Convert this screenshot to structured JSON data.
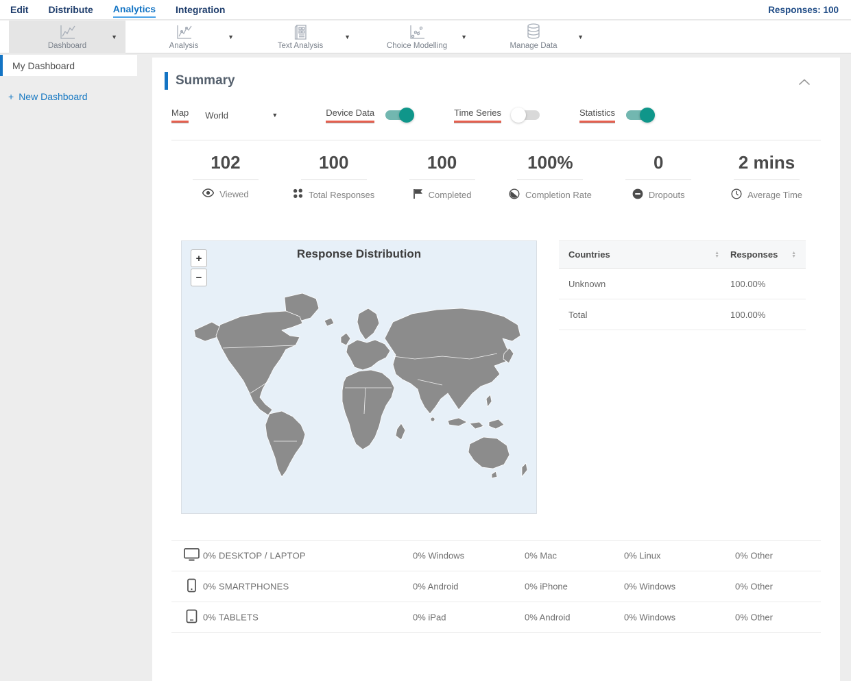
{
  "top_nav": {
    "items": [
      {
        "label": "Edit",
        "active": false
      },
      {
        "label": "Distribute",
        "active": false
      },
      {
        "label": "Analytics",
        "active": true
      },
      {
        "label": "Integration",
        "active": false
      }
    ],
    "responses_label": "Responses: 100"
  },
  "toolbar": {
    "items": [
      {
        "label": "Dashboard",
        "icon": "dashboard-chart-icon",
        "selected": true
      },
      {
        "label": "Analysis",
        "icon": "analysis-chart-icon",
        "selected": false
      },
      {
        "label": "Text Analysis",
        "icon": "text-analysis-document-icon",
        "selected": false
      },
      {
        "label": "Choice Modelling",
        "icon": "choice-modelling-scatter-icon",
        "selected": false
      },
      {
        "label": "Manage Data",
        "icon": "database-icon",
        "selected": false
      }
    ]
  },
  "sidebar": {
    "items": [
      {
        "label": "My Dashboard",
        "active": true
      }
    ],
    "new_dashboard": {
      "plus": "+",
      "label": "New Dashboard"
    }
  },
  "summary": {
    "title": "Summary",
    "controls": {
      "map_label": "Map",
      "map_value": "World",
      "toggles": [
        {
          "label": "Device Data",
          "on": true
        },
        {
          "label": "Time Series",
          "on": false
        },
        {
          "label": "Statistics",
          "on": true
        }
      ]
    },
    "stats": [
      {
        "value": "102",
        "label": "Viewed",
        "icon": "eye-icon"
      },
      {
        "value": "100",
        "label": "Total Responses",
        "icon": "dots-grid-icon"
      },
      {
        "value": "100",
        "label": "Completed",
        "icon": "flag-icon"
      },
      {
        "value": "100%",
        "label": "Completion Rate",
        "icon": "contrast-circle-icon"
      },
      {
        "value": "0",
        "label": "Dropouts",
        "icon": "minus-circle-icon"
      },
      {
        "value": "2 mins",
        "label": "Average Time",
        "icon": "clock-icon"
      }
    ],
    "map": {
      "title": "Response Distribution",
      "zoom_in": "+",
      "zoom_out": "−"
    },
    "countries_table": {
      "col_country": "Countries",
      "col_responses": "Responses",
      "rows": [
        {
          "country": "Unknown",
          "responses": "100.00%"
        },
        {
          "country": "Total",
          "responses": "100.00%"
        }
      ]
    },
    "device_table": {
      "rows": [
        {
          "icon": "desktop-icon",
          "label": "0% DESKTOP / LAPTOP",
          "c1": "0% Windows",
          "c2": "0% Mac",
          "c3": "0% Linux",
          "c4": "0% Other"
        },
        {
          "icon": "smartphone-icon",
          "label": "0% SMARTPHONES",
          "c1": "0% Android",
          "c2": "0% iPhone",
          "c3": "0% Windows",
          "c4": "0% Other"
        },
        {
          "icon": "tablet-icon",
          "label": "0% TABLETS",
          "c1": "0% iPad",
          "c2": "0% Android",
          "c3": "0% Windows",
          "c4": "0% Other"
        }
      ]
    }
  },
  "colors": {
    "nav_navy": "#1d3c6b",
    "link_blue": "#1374c4",
    "accent_underline_red": "#e8604f",
    "toggle_on_track": "#72b7b0",
    "toggle_on_knob": "#0f968a",
    "map_ocean": "#e7f0f8",
    "map_land": "#8c8c8c",
    "sidebar_bg": "#ededed"
  }
}
